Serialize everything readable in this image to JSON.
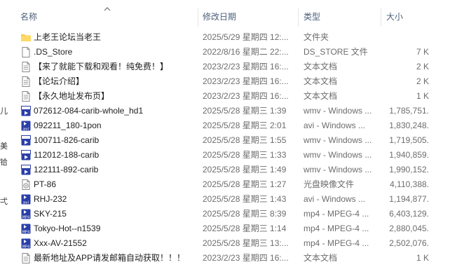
{
  "columns": {
    "name": "名称",
    "date": "修改日期",
    "type": "类型",
    "size": "大小"
  },
  "left_strip": [
    "儿",
    "美",
    "铪",
    "弌"
  ],
  "files": [
    {
      "icon": "folder-icon",
      "name": "上老王论坛当老王",
      "date": "2025/5/29 星期四 12:...",
      "type": "文件夹",
      "size": ""
    },
    {
      "icon": "blank-file-icon",
      "name": ".DS_Store",
      "date": "2022/8/16 星期二 22:...",
      "type": "DS_STORE 文件",
      "size": "7 K"
    },
    {
      "icon": "text-file-icon",
      "name": "【来了就能下载和观看！纯免费！】",
      "date": "2023/2/23 星期四 16:...",
      "type": "文本文档",
      "size": "2 K"
    },
    {
      "icon": "text-file-icon",
      "name": "【论坛介绍】",
      "date": "2023/2/23 星期四 16:...",
      "type": "文本文档",
      "size": "2 K"
    },
    {
      "icon": "text-file-icon",
      "name": "【永久地址发布页】",
      "date": "2023/2/23 星期四 16:...",
      "type": "文本文档",
      "size": "1 K"
    },
    {
      "icon": "wmv-video-icon",
      "name": "072612-084-carib-whole_hd1",
      "date": "2025/5/28 星期三 1:39",
      "type": "wmv - Windows ...",
      "size": "1,785,751."
    },
    {
      "icon": "avi-video-icon",
      "name": "092211_180-1pon",
      "date": "2025/5/28 星期三 2:01",
      "type": "avi - Windows ...",
      "size": "1,830,248."
    },
    {
      "icon": "wmv-video-icon",
      "name": "100711-826-carib",
      "date": "2025/5/28 星期三 1:55",
      "type": "wmv - Windows ...",
      "size": "1,719,505."
    },
    {
      "icon": "wmv-video-icon",
      "name": "112012-188-carib",
      "date": "2025/5/28 星期三 1:33",
      "type": "wmv - Windows ...",
      "size": "1,940,859."
    },
    {
      "icon": "wmv-video-icon",
      "name": "122111-892-carib",
      "date": "2025/5/28 星期三 1:49",
      "type": "wmv - Windows ...",
      "size": "1,990,152."
    },
    {
      "icon": "disc-image-icon",
      "name": "PT-86",
      "date": "2025/5/28 星期三 1:27",
      "type": "光盘映像文件",
      "size": "4,110,388."
    },
    {
      "icon": "avi-video-icon",
      "name": "RHJ-232",
      "date": "2025/5/28 星期三 1:43",
      "type": "avi - Windows ...",
      "size": "1,194,877."
    },
    {
      "icon": "mp4-video-icon",
      "name": "SKY-215",
      "date": "2025/5/28 星期三 8:39",
      "type": "mp4 - MPEG-4 ...",
      "size": "6,403,129."
    },
    {
      "icon": "mp4-video-icon",
      "name": "Tokyo-Hot--n1539",
      "date": "2025/5/28 星期三 1:14",
      "type": "mp4 - MPEG-4 ...",
      "size": "2,880,045."
    },
    {
      "icon": "mp4-video-icon",
      "name": "Xxx-AV-21552",
      "date": "2025/5/28 星期三 13:...",
      "type": "mp4 - MPEG-4 ...",
      "size": "2,502,076."
    },
    {
      "icon": "text-file-icon",
      "name": "最新地址及APP请发邮箱自动获取！！！",
      "date": "2023/2/23 星期四 16:...",
      "type": "文本文档",
      "size": "1 K"
    }
  ]
}
